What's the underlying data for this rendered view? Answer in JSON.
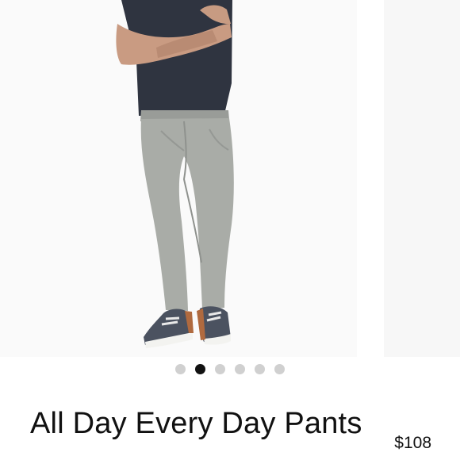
{
  "product": {
    "title": "All Day Every Day Pants",
    "price": "$108",
    "image_subject": "man in navy t-shirt, light gray pants and sneakers"
  },
  "gallery": {
    "slide_count": 6,
    "active_index": 1
  },
  "colors": {
    "shirt": "#2f3440",
    "pants": "#a9aca7",
    "background": "#fafafa",
    "dot_active": "#111111",
    "dot_inactive": "#d0d0d0"
  },
  "icons": {
    "dots": "pagination-dot"
  }
}
